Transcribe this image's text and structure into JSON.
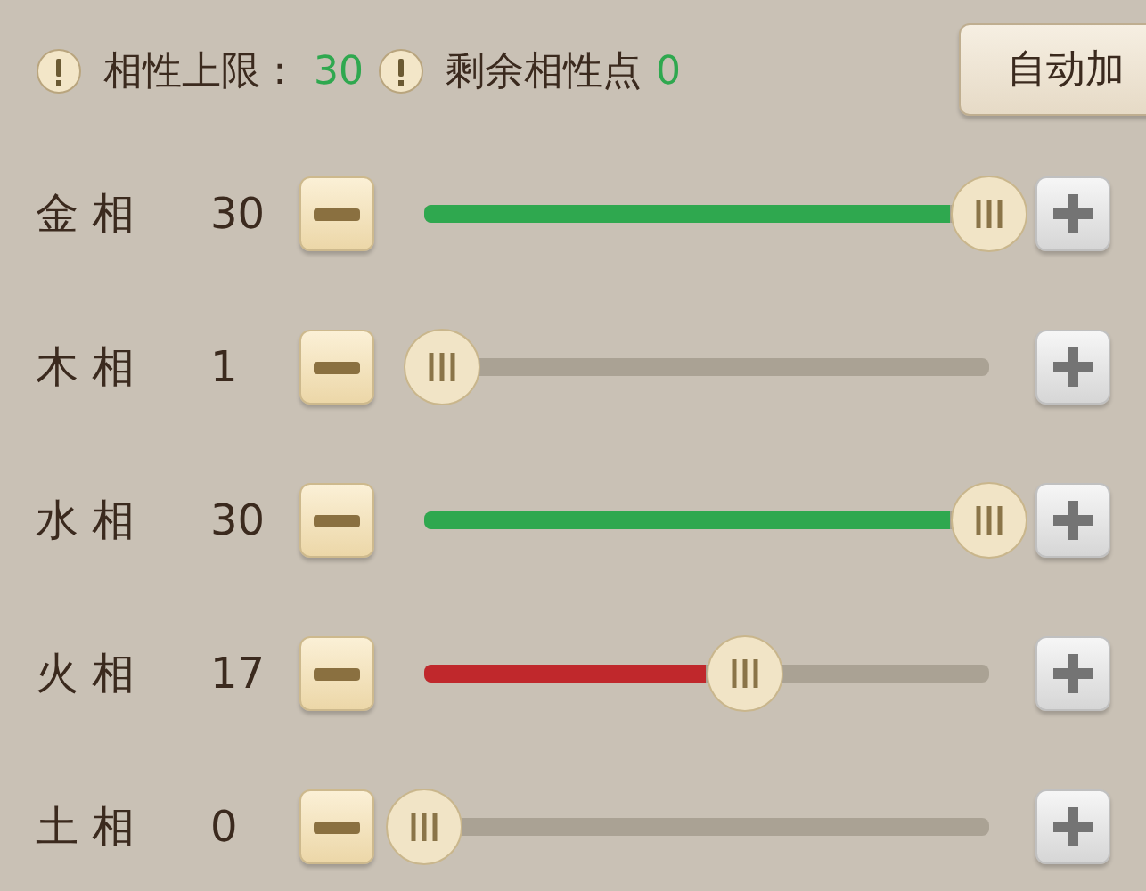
{
  "header": {
    "limit_label": "相性上限：",
    "limit_value": "30",
    "remaining_label": "剩余相性点",
    "remaining_value": "0",
    "auto_button": "自动加"
  },
  "attributes": [
    {
      "name": "金 相",
      "value": "30",
      "level": 1,
      "color": "#2fa84f"
    },
    {
      "name": "木 相",
      "value": "1",
      "level": 0.033
    },
    {
      "name": "水 相",
      "value": "30",
      "level": 1,
      "color": "#2fa84f"
    },
    {
      "name": "火 相",
      "value": "17",
      "level": 0.567,
      "color": "#c0282c"
    },
    {
      "name": "土 相",
      "value": "0",
      "level": 0
    }
  ]
}
